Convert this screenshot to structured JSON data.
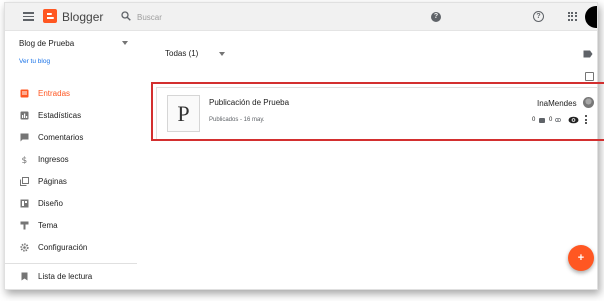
{
  "header": {
    "app_name": "Blogger",
    "search_placeholder": "Buscar",
    "help_glyph": "?",
    "help_outline_glyph": "?",
    "brand_color": "#ff5722"
  },
  "sidebar": {
    "blog_name": "Blog de Prueba",
    "view_blog_label": "Ver tu blog",
    "items": [
      {
        "label": "Entradas",
        "icon": "posts-icon",
        "active": true
      },
      {
        "label": "Estadísticas",
        "icon": "stats-icon",
        "active": false
      },
      {
        "label": "Comentarios",
        "icon": "comments-icon",
        "active": false
      },
      {
        "label": "Ingresos",
        "icon": "dollar-icon",
        "active": false
      },
      {
        "label": "Páginas",
        "icon": "pages-icon",
        "active": false
      },
      {
        "label": "Diseño",
        "icon": "layout-icon",
        "active": false
      },
      {
        "label": "Tema",
        "icon": "theme-icon",
        "active": false
      },
      {
        "label": "Configuración",
        "icon": "gear-icon",
        "active": false
      },
      {
        "label": "Lista de lectura",
        "icon": "bookmark-icon",
        "active": false
      }
    ]
  },
  "main": {
    "filter_label": "Todas (1)",
    "posts": [
      {
        "thumb_letter": "P",
        "title": "Publicación de Prueba",
        "meta": "Publicados - 16 may.",
        "author": "InaMendes",
        "comments": "0",
        "views": "0"
      }
    ]
  },
  "fab": {
    "label": "+"
  },
  "colors": {
    "accent": "#ff5722",
    "highlight": "#d32f2f",
    "link": "#1a73e8"
  }
}
